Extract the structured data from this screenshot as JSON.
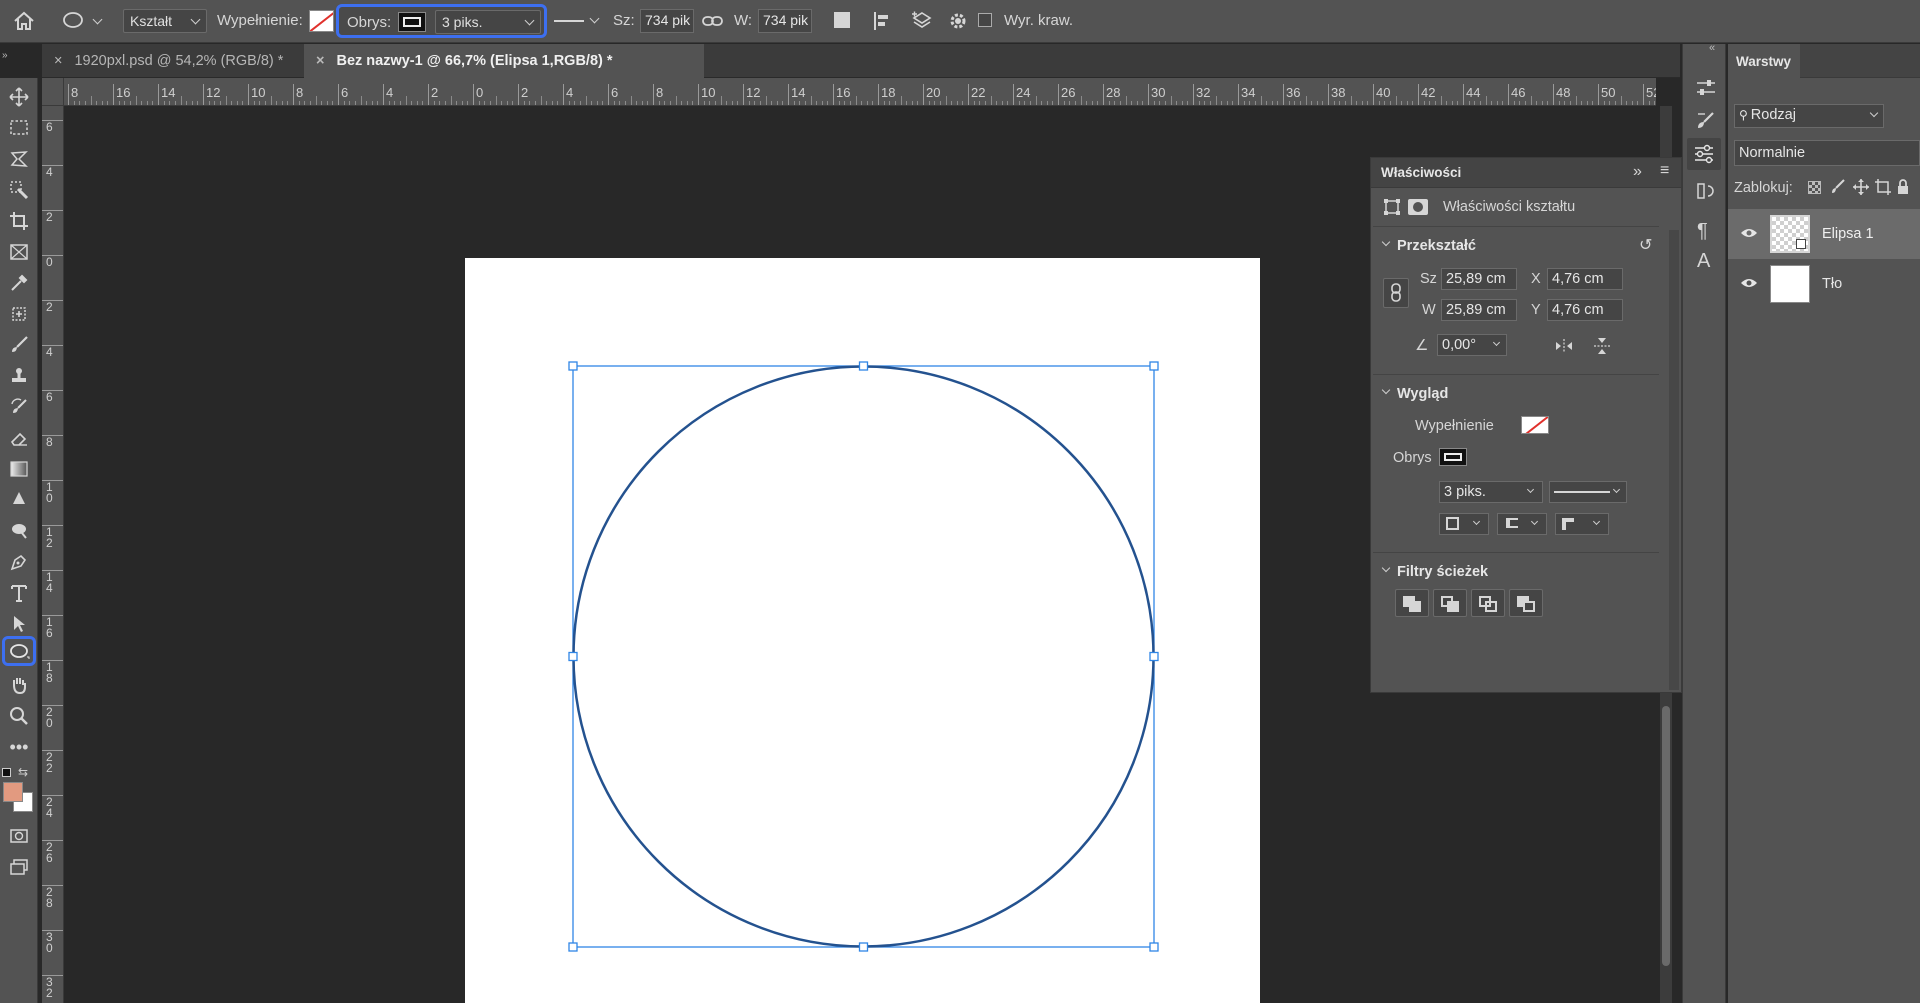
{
  "options_bar": {
    "tool_mode": "Kształt",
    "fill_label": "Wypełnienie:",
    "stroke_label": "Obrys:",
    "stroke_width": "3 piks.",
    "width_label": "Sz:",
    "width_value": "734 pik",
    "height_label": "W:",
    "height_value": "734 pik",
    "align_edges_label": "Wyr. kraw."
  },
  "tabs": [
    {
      "label": "1920pxl.psd @ 54,2% (RGB/8) *",
      "active": false
    },
    {
      "label": "Bez nazwy-1 @ 66,7% (Elipsa 1,RGB/8) *",
      "active": true
    }
  ],
  "ruler": {
    "top": [
      "8",
      "16",
      "14",
      "12",
      "10",
      "8",
      "6",
      "4",
      "2",
      "0",
      "2",
      "4",
      "6",
      "8",
      "10",
      "12",
      "14",
      "16",
      "18",
      "20",
      "22",
      "24",
      "26",
      "28",
      "30",
      "32",
      "34",
      "36",
      "38",
      "40",
      "42",
      "44",
      "46",
      "48",
      "50",
      "52"
    ],
    "left": [
      "6",
      "4",
      "2",
      "0",
      "2",
      "4",
      "6",
      "8",
      "1 0",
      "1 2",
      "1 4",
      "1 6",
      "1 8",
      "2 0",
      "2 2",
      "2 4",
      "2 6",
      "2 8",
      "3 0",
      "3 2"
    ]
  },
  "properties": {
    "title": "Właściwości",
    "subtitle": "Właściwości kształtu",
    "transform_section": "Przekształć",
    "w_label": "Sz",
    "w_value": "25,89 cm",
    "h_label": "W",
    "h_value": "25,89 cm",
    "x_label": "X",
    "x_value": "4,76 cm",
    "y_label": "Y",
    "y_value": "4,76 cm",
    "angle_value": "0,00°",
    "appearance_section": "Wygląd",
    "fill_label": "Wypełnienie",
    "stroke_label": "Obrys",
    "stroke_width": "3 piks.",
    "path_filters_section": "Filtry ścieżek"
  },
  "layers_panel": {
    "title": "Warstwy",
    "filter_kind": "Rodzaj",
    "blend_mode": "Normalnie",
    "lock_label": "Zablokuj:",
    "layers": [
      {
        "name": "Elipsa 1",
        "selected": true
      },
      {
        "name": "Tło",
        "selected": false
      }
    ]
  },
  "colors": {
    "ui_bg": "#535353",
    "canvas_bg": "#282828",
    "highlight": "#3d6ff0",
    "ellipse_stroke": "#24528f",
    "bbox": "#2f86e6",
    "foreground_color": "#e29a80"
  }
}
